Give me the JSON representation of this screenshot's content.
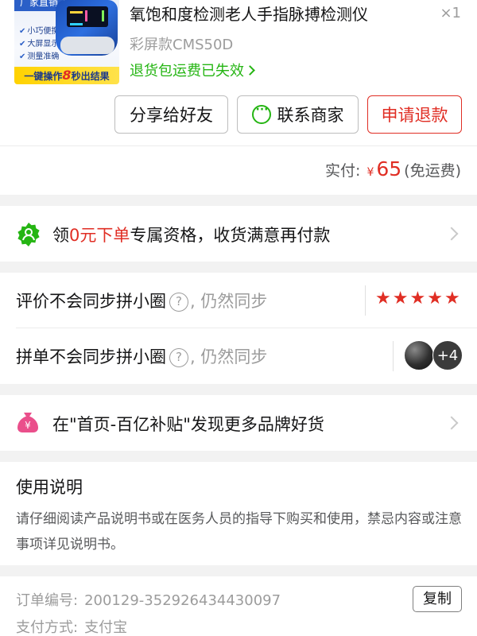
{
  "product": {
    "thumb_badge": "厂家直销",
    "thumb_features": [
      "小巧便携",
      "大屏显示",
      "测量准确"
    ],
    "thumb_slogan_a": "一键操作",
    "thumb_slogan_num": "8",
    "thumb_slogan_b": "秒出结果",
    "title": "氧饱和度检测老人手指脉搏检测仪",
    "quantity": "×1",
    "spec": "彩屏款CMS50D",
    "return_notice": "退货包运费已失效"
  },
  "actions": {
    "share": "分享给好友",
    "contact": "联系商家",
    "refund": "申请退款"
  },
  "payment": {
    "label": "实付:",
    "currency": "¥",
    "amount": "65",
    "shipping": "(免运费)"
  },
  "promo": {
    "prefix": "领",
    "highlight": "0元下单",
    "suffix": "专属资格，收货满意再付款"
  },
  "sync": {
    "review_label": "评价不会同步拼小圈",
    "review_action": ", 仍然同步",
    "review_stars": 5,
    "group_label": "拼单不会同步拼小圈",
    "group_action": ", 仍然同步",
    "group_more": "+4"
  },
  "subsidy": {
    "text": "在\"首页-百亿补贴\"发现更多品牌好货"
  },
  "usage": {
    "title": "使用说明",
    "body": "请仔细阅读产品说明书或在医务人员的指导下购买和使用，禁忌内容或注意事项详见说明书。"
  },
  "order": {
    "number_label": "订单编号:",
    "number": "200129-352926434430097",
    "copy": "复制",
    "payment_label": "支付方式:",
    "payment_method": "支付宝"
  },
  "colors": {
    "accent_red": "#e02e24",
    "accent_green": "#25b513",
    "text_gray": "#9c9c9c"
  }
}
